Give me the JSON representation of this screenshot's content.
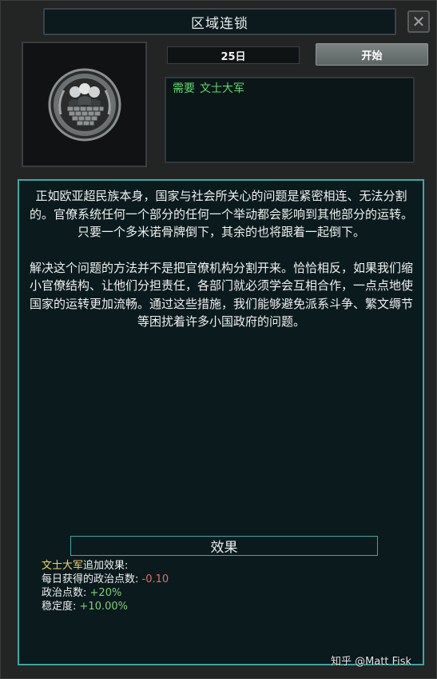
{
  "window": {
    "title": "区域连锁",
    "close_glyph": "✕"
  },
  "focus": {
    "emblem_icon": "bureaucrats-emblem",
    "days": "25日",
    "start_label": "开始",
    "requirement": {
      "prefix": "需要",
      "value": "文士大军"
    }
  },
  "description": {
    "paragraphs": [
      "正如欧亚超民族本身，国家与社会所关心的问题是紧密相连、无法分割的。官僚系统任何一个部分的任何一个举动都会影响到其他部分的运转。只要一个多米诺骨牌倒下，其余的也将跟着一起倒下。",
      "解决这个问题的方法并不是把官僚机构分割开来。恰恰相反，如果我们缩小官僚结构、让他们分担责任，各部门就必须学会互相合作，一点点地使国家的运转更加流畅。通过这些措施，我们能够避免派系斗争、繁文缛节等困扰着许多小国政府的问题。"
    ]
  },
  "effects": {
    "header": "效果",
    "target": "文士大军",
    "target_suffix": "追加效果:",
    "rows": [
      {
        "label": "每日获得的政治点数:",
        "value": "-0.10",
        "tone": "neg"
      },
      {
        "label": "政治点数:",
        "value": "+20%",
        "tone": "pos"
      },
      {
        "label": "稳定度:",
        "value": "+10.00%",
        "tone": "pos"
      }
    ]
  },
  "watermark": "知乎 @Matt Fisk",
  "colors": {
    "accent_border": "#3aa9a5",
    "requirement_text": "#5fd86a",
    "highlight_yellow": "#f1d76b",
    "negative": "#e0706a",
    "positive": "#7fd07a"
  }
}
